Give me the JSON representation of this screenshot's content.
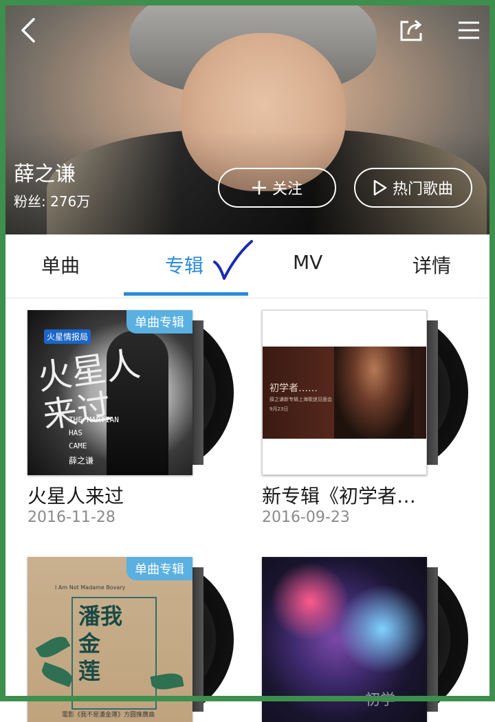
{
  "header": {
    "artist_name": "薛之谦",
    "fans_text": "粉丝: 276万",
    "follow_label": "关注",
    "hot_songs_label": "热门歌曲",
    "icons": {
      "back": "chevron-left-icon",
      "share": "share-icon",
      "menu": "hamburger-menu-icon"
    }
  },
  "tabs": [
    {
      "label": "单曲",
      "active": false
    },
    {
      "label": "专辑",
      "active": true
    },
    {
      "label": "MV",
      "active": false
    },
    {
      "label": "详情",
      "active": false
    }
  ],
  "colors": {
    "accent": "#2a8bd8",
    "badge": "#5ab0e0",
    "frame": "#3e8e4d",
    "checkmark": "#1a2bb5"
  },
  "albums": [
    {
      "title": "火星人来过",
      "date": "2016-11-28",
      "badge": "单曲专辑",
      "cover": {
        "logo": "火星情报局",
        "title_lines": [
          "火星人",
          "来过"
        ],
        "english_lines": [
          "THE MARTIAN",
          "HAS",
          "CAME"
        ],
        "signature": "薛之谦"
      }
    },
    {
      "title": "新专辑《初学者…",
      "date": "2016-09-23",
      "badge": "",
      "cover": {
        "title": "初学者……",
        "subtitle": "薛之谦新专辑上海歌迷见面会",
        "date": "9月23日"
      }
    },
    {
      "title": "",
      "date": "",
      "badge": "单曲专辑",
      "cover": {
        "top_caption": "I Am Not Madame Bovary",
        "characters": [
          "潘我",
          "金",
          "莲"
        ],
        "bottom_caption": "電影《我不是潘金蓮》方圆推廣曲"
      }
    },
    {
      "title": "",
      "date": "",
      "badge": "",
      "cover": {
        "text": "初学"
      }
    }
  ]
}
